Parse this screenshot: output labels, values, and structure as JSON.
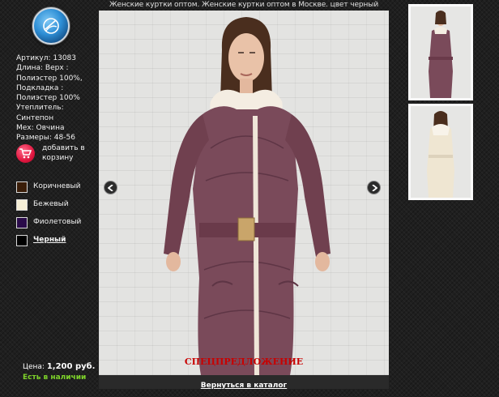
{
  "header": {
    "title": "Женские куртки оптом. Женские куртки оптом в Москве. цвет черный"
  },
  "logo": {
    "icon": "globe-logo-icon"
  },
  "specs": {
    "article": "Артикул: 13083",
    "length": "Длина: Верх :",
    "outer": "Полиэстер 100%,",
    "lining_label": "Подкладка :",
    "lining": "Полиэстер 100%",
    "insulation_label": "Утеплитель:",
    "insulation": "Синтепон",
    "fur": "Мех: Овчина",
    "sizes": "Размеры: 48-56"
  },
  "cart": {
    "label": "добавить в корзину",
    "icon": "cart-icon"
  },
  "colors": {
    "items": [
      {
        "label": "Коричневый",
        "hex": "#3a1d08"
      },
      {
        "label": "Бежевый",
        "hex": "#f6efd6"
      },
      {
        "label": "Фиолетовый",
        "hex": "#2a0b4a"
      },
      {
        "label": "Черный",
        "hex": "#000000"
      }
    ],
    "selected": "Черный"
  },
  "price": {
    "label": "Цена:",
    "value": "1,200 руб."
  },
  "stock": "Есть в наличии",
  "main": {
    "special_offer": "СПЕЦПРЕДЛОЖЕНИЕ",
    "back_link": "Вернуться в каталог",
    "jacket_color": "#7a4a5a"
  },
  "thumbnails": [
    {
      "name": "thumbnail-mauve-jacket",
      "color": "#7a4a5a"
    },
    {
      "name": "thumbnail-cream-jacket-back",
      "color": "#efe6d2"
    }
  ]
}
